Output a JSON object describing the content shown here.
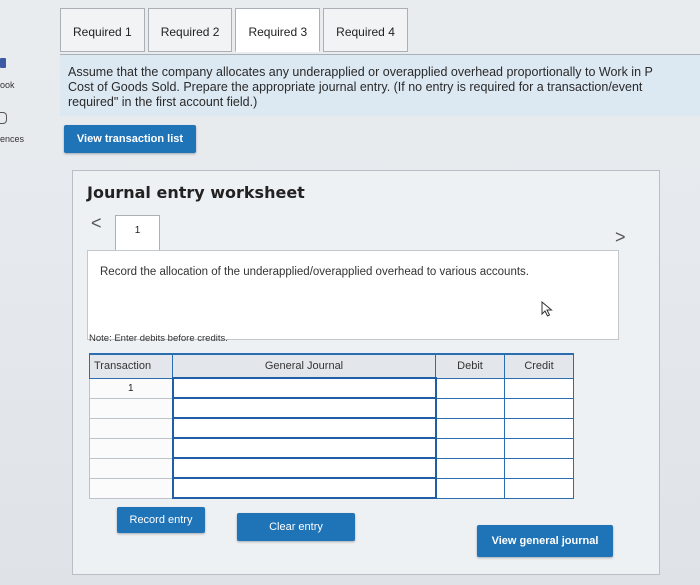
{
  "sidebar": {
    "items": [
      {
        "label": "ook",
        "icon": "book-icon"
      },
      {
        "label": "ences",
        "icon": "references-icon"
      }
    ]
  },
  "tabs": [
    {
      "label": "Required 1",
      "active": false
    },
    {
      "label": "Required 2",
      "active": false
    },
    {
      "label": "Required 3",
      "active": true
    },
    {
      "label": "Required 4",
      "active": false
    }
  ],
  "instructions": {
    "line1": "Assume that the company allocates any underapplied or overapplied overhead proportionally to Work in P",
    "line2": "Cost of Goods Sold. Prepare the appropriate journal entry. (If no entry is required for a transaction/event",
    "line3": "required\" in the first account field.)"
  },
  "buttons": {
    "view_transaction_list": "View transaction list",
    "record_entry": "Record entry",
    "clear_entry": "Clear entry",
    "view_general_journal": "View general journal"
  },
  "worksheet": {
    "title": "Journal entry worksheet",
    "prev_icon": "<",
    "next_icon": ">",
    "entry_number": "1",
    "description": "Record the allocation of the underapplied/overapplied overhead to various accounts.",
    "note": "Note: Enter debits before credits."
  },
  "journal": {
    "headers": [
      "Transaction",
      "General Journal",
      "Debit",
      "Credit"
    ],
    "rows": [
      {
        "transaction": "1",
        "account": "",
        "debit": "",
        "credit": ""
      },
      {
        "transaction": "",
        "account": "",
        "debit": "",
        "credit": ""
      },
      {
        "transaction": "",
        "account": "",
        "debit": "",
        "credit": ""
      },
      {
        "transaction": "",
        "account": "",
        "debit": "",
        "credit": ""
      },
      {
        "transaction": "",
        "account": "",
        "debit": "",
        "credit": ""
      },
      {
        "transaction": "",
        "account": "",
        "debit": "",
        "credit": ""
      }
    ]
  },
  "colors": {
    "accent": "#1f73b7",
    "instructions_bg": "#dce8f2",
    "grid_line": "#2b6eb0"
  }
}
